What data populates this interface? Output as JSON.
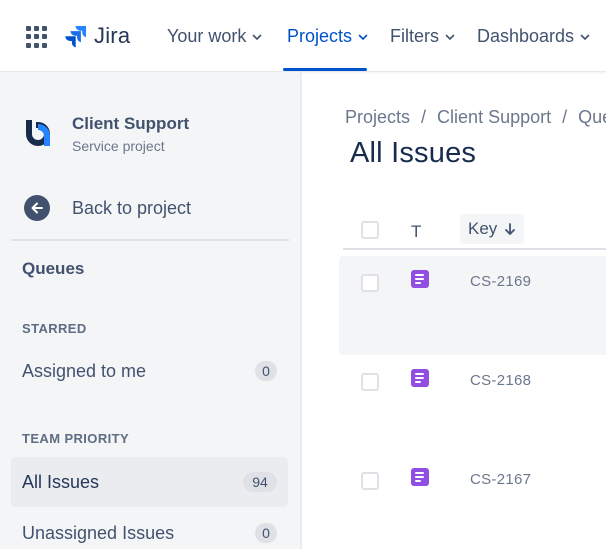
{
  "topnav": {
    "app_name": "Jira",
    "items": [
      {
        "label": "Your work"
      },
      {
        "label": "Projects"
      },
      {
        "label": "Filters"
      },
      {
        "label": "Dashboards"
      }
    ],
    "active_item": "Projects",
    "accent_color": "#0052cc"
  },
  "sidebar": {
    "project_name": "Client Support",
    "project_type": "Service project",
    "back_label": "Back to project",
    "queues_title": "Queues",
    "sections": [
      {
        "title": "STARRED",
        "items": [
          {
            "label": "Assigned to me",
            "count": "0"
          }
        ]
      },
      {
        "title": "TEAM PRIORITY",
        "items": [
          {
            "label": "All Issues",
            "count": "94",
            "selected": true
          },
          {
            "label": "Unassigned Issues",
            "count": "0"
          }
        ]
      }
    ]
  },
  "main": {
    "breadcrumb": [
      "Projects",
      "Client Support",
      "Que"
    ],
    "breadcrumb_separator": "/",
    "title": "All Issues",
    "columns": {
      "type": "T",
      "key": "Key"
    },
    "rows": [
      {
        "key": "CS-2169",
        "type_icon": "service-request-icon"
      },
      {
        "key": "CS-2168",
        "type_icon": "service-request-icon"
      },
      {
        "key": "CS-2167",
        "type_icon": "service-request-icon"
      }
    ],
    "issue_icon_color": "#904ee2"
  }
}
